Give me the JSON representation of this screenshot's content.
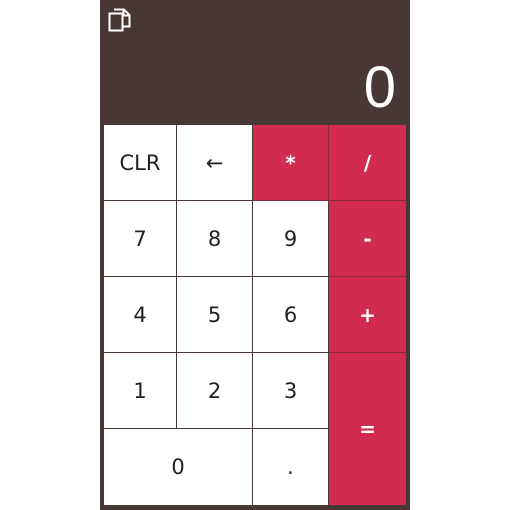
{
  "display": {
    "value": "0"
  },
  "toolbar": {
    "copy_icon": "copy-icon"
  },
  "keys": {
    "clr": "CLR",
    "back": "←",
    "mul": "*",
    "div": "/",
    "k7": "7",
    "k8": "8",
    "k9": "9",
    "sub": "-",
    "k4": "4",
    "k5": "5",
    "k6": "6",
    "add": "+",
    "k1": "1",
    "k2": "2",
    "k3": "3",
    "eq": "=",
    "k0": "0",
    "dot": "."
  },
  "colors": {
    "background": "#473735",
    "operator": "#d22b50",
    "key": "#ffffff"
  }
}
